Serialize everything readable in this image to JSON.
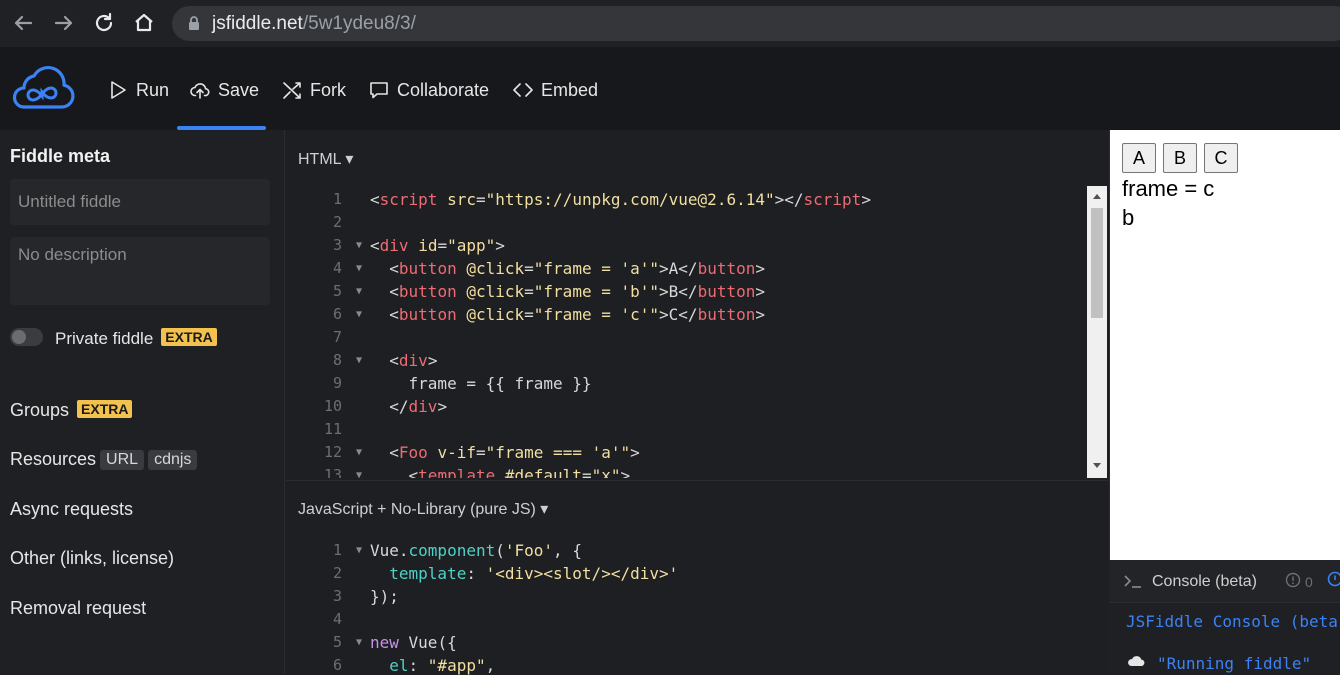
{
  "browser": {
    "url_host": "jsfiddle.net",
    "url_path": "/5w1ydeu8/3/"
  },
  "toolbar": {
    "run_label": "Run",
    "save_label": "Save",
    "fork_label": "Fork",
    "collaborate_label": "Collaborate",
    "embed_label": "Embed",
    "accent_color": "#3b82f6"
  },
  "sidebar": {
    "meta_title": "Fiddle meta",
    "title_placeholder": "Untitled fiddle",
    "description_placeholder": "No description",
    "private_label": "Private fiddle",
    "extra_badge": "EXTRA",
    "groups_label": "Groups",
    "resources_label": "Resources",
    "resources_url": "URL",
    "resources_cdnjs": "cdnjs",
    "async_label": "Async requests",
    "other_label": "Other (links, license)",
    "removal_label": "Removal request"
  },
  "html_panel": {
    "title": "HTML",
    "lines": [
      "1",
      "2",
      "3",
      "4",
      "5",
      "6",
      "7",
      "8",
      "9",
      "10",
      "11",
      "12",
      "13"
    ]
  },
  "js_panel": {
    "title": "JavaScript + No-Library (pure JS)",
    "lines": [
      "1",
      "2",
      "3",
      "4",
      "5",
      "6"
    ]
  },
  "result": {
    "buttons": [
      "A",
      "B",
      "C"
    ],
    "frame_text": "frame = c",
    "slot_text": "b"
  },
  "console": {
    "title": "Console (beta)",
    "error_count": "0",
    "banner": "JSFiddle Console (beta",
    "log": "\"Running fiddle\""
  }
}
